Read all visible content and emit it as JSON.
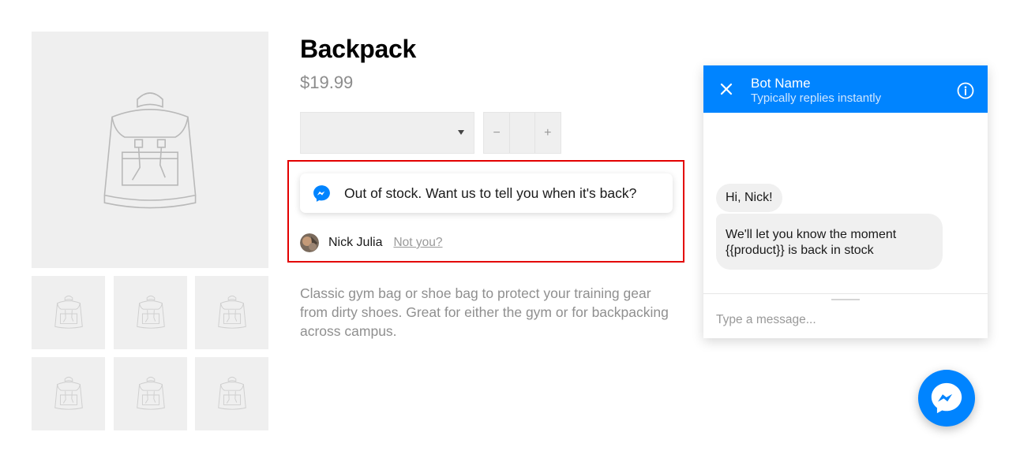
{
  "product": {
    "title": "Backpack",
    "price": "$19.99",
    "description": "Classic gym bag or shoe bag to protect your training gear from dirty shoes. Great for either the gym or for backpacking across campus.",
    "variant_selected": "",
    "quantity": {
      "minus": "−",
      "plus": "+",
      "value": ""
    }
  },
  "gallery": {
    "main_icon": "backpack-icon",
    "thumbnail_icon": "backpack-icon",
    "thumbnail_count": 6
  },
  "messenger_plugin": {
    "message": "Out of stock. Want us to tell you when it's back?",
    "user_name": "Nick Julia",
    "not_you": "Not you?"
  },
  "chat": {
    "bot_name": "Bot Name",
    "status": "Typically replies instantly",
    "messages": [
      "Hi, Nick!",
      "We'll let you know the moment {{product}} is back in stock"
    ],
    "placeholder": "Type a message..."
  },
  "colors": {
    "messenger_blue": "#0084ff",
    "highlight_red": "#e30000",
    "placeholder_gray": "#efefef",
    "muted_text": "#8f8f8f"
  }
}
